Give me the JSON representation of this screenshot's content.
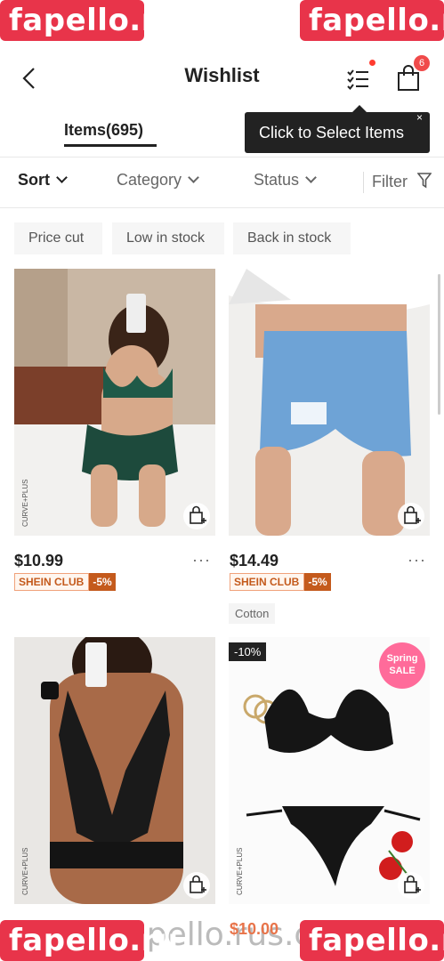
{
  "header": {
    "title": "Wishlist",
    "bag_count": "6"
  },
  "tabs": {
    "items_label": "Items(695)"
  },
  "tooltip": {
    "text": "Click to Select Items",
    "close": "×"
  },
  "filters": {
    "sort": "Sort",
    "category": "Category",
    "status": "Status",
    "filter": "Filter"
  },
  "chips": [
    "Price cut",
    "Low in stock",
    "Back in stock"
  ],
  "products": [
    {
      "price": "$10.99",
      "club": "SHEIN CLUB",
      "club_discount": "-5%",
      "brand": "CURVE+PLUS",
      "more": "···"
    },
    {
      "price": "$14.49",
      "club": "SHEIN CLUB",
      "club_discount": "-5%",
      "attribute": "Cotton",
      "more": "···"
    },
    {
      "brand": "CURVE+PLUS"
    },
    {
      "discount_badge": "-10%",
      "promo": "Spring SALE",
      "brand": "CURVE+PLUS",
      "price_partial": "$10.00"
    }
  ],
  "watermark": {
    "brand": "fapello.ru",
    "url": "fapello.rus.com/au"
  },
  "colors": {
    "accent": "#e8344a",
    "club": "#c45a1c",
    "badge": "#f04a4a"
  }
}
